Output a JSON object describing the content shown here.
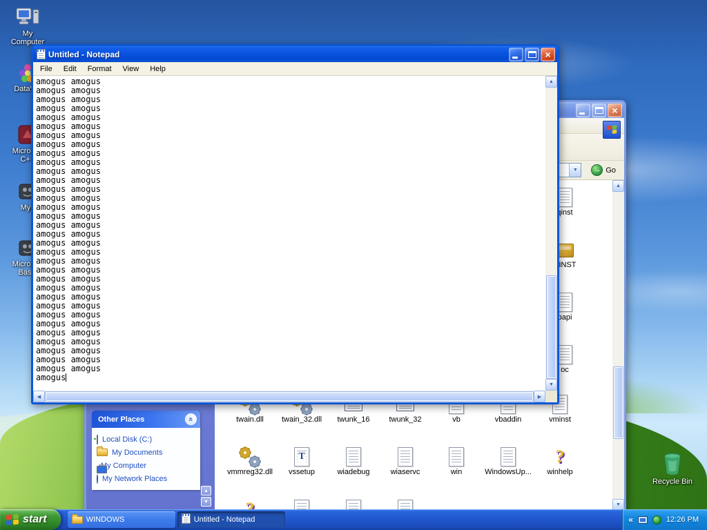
{
  "theme": {
    "titlebar_active_blue": "#0a55e2",
    "titlebar_inactive_blue": "#7697e6",
    "taskbar_blue": "#2157cf",
    "start_green": "#3f9a34",
    "taskpane_blue": "#6a79d1",
    "other_places_header_blue": "#3a74ee",
    "desktop_sky": "#5a97dd",
    "desktop_grass": "#418f21",
    "close_button_red": "#c43c14"
  },
  "desktop": {
    "icons": [
      {
        "name": "my-computer",
        "label": "My Computer",
        "icon": "computer"
      },
      {
        "name": "datawarehouse",
        "label": "DataWa",
        "icon": "flower"
      },
      {
        "name": "microsoft-cpp",
        "label": "Microsoft C++",
        "icon": "app-maroon"
      },
      {
        "name": "myp",
        "label": "Myp",
        "icon": "app-dark"
      },
      {
        "name": "microsoft-basic",
        "label": "Microsoft Basic",
        "icon": "app-dark"
      }
    ],
    "recycle_bin": {
      "label": "Recycle Bin",
      "icon": "recycle-bin"
    }
  },
  "notepad_window": {
    "title": "Untitled - Notepad",
    "menu_items": [
      "File",
      "Edit",
      "Format",
      "View",
      "Help"
    ],
    "text": {
      "repeated_line": "amogus amogus",
      "repeat_count": 33,
      "last_line": "amogus"
    }
  },
  "explorer_window": {
    "address_bar": {
      "go_label": "Go"
    },
    "file_grid": {
      "partial_right_column": [
        {
          "label": "qinst",
          "icon": "doc"
        },
        {
          "label": "CINST",
          "icon": "installer"
        },
        {
          "label": "papi",
          "icon": "doc"
        },
        {
          "label": "oc",
          "icon": "doc"
        }
      ],
      "row1": [
        {
          "label": "twain.dll",
          "icon": "dll"
        },
        {
          "label": "twain_32.dll",
          "icon": "dll"
        },
        {
          "label": "twunk_16",
          "icon": "dos"
        },
        {
          "label": "twunk_32",
          "icon": "dos"
        },
        {
          "label": "vb",
          "icon": "doc"
        },
        {
          "label": "vbaddin",
          "icon": "doc"
        },
        {
          "label": "vminst",
          "icon": "doc"
        }
      ],
      "row2": [
        {
          "label": "vmmreg32.dll",
          "icon": "dll"
        },
        {
          "label": "vssetup",
          "icon": "font"
        },
        {
          "label": "wiadebug",
          "icon": "doc"
        },
        {
          "label": "wiaservc",
          "icon": "doc"
        },
        {
          "label": "win",
          "icon": "doc"
        },
        {
          "label": "WindowsUp...",
          "icon": "doc"
        },
        {
          "label": "winhelp",
          "icon": "help"
        }
      ],
      "row3_partial_icons": [
        "help",
        "doc",
        "doc",
        "doc"
      ]
    },
    "other_places": {
      "title": "Other Places",
      "items": [
        {
          "label": "Local Disk (C:)",
          "icon": "disk"
        },
        {
          "label": "My Documents",
          "icon": "folder-docs"
        },
        {
          "label": "My Computer",
          "icon": "computer-small"
        },
        {
          "label": "My Network Places",
          "icon": "network"
        }
      ]
    }
  },
  "taskbar": {
    "start_button": "start",
    "tasks": [
      {
        "label": "WINDOWS",
        "icon": "folder",
        "active": false
      },
      {
        "label": "Untitled - Notepad",
        "icon": "notepad",
        "active": true
      }
    ],
    "tray": {
      "icons": [
        "collapse-chevron",
        "display",
        "shield"
      ],
      "clock": "12:26 PM"
    }
  }
}
